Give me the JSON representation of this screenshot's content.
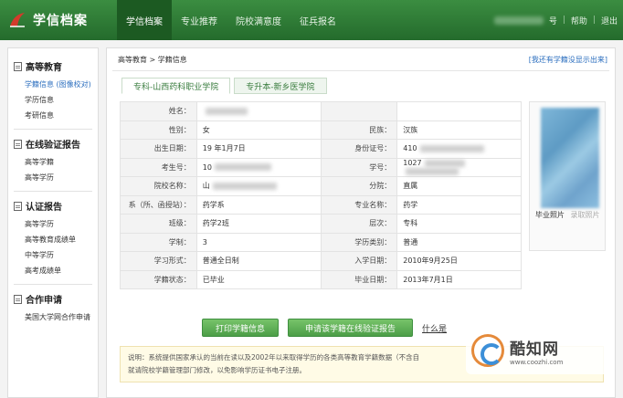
{
  "header": {
    "app_title": "学信档案",
    "nav": [
      "学信档案",
      "专业推荐",
      "院校满意度",
      "征兵报名"
    ],
    "right_links": [
      "号",
      "帮助",
      "退出"
    ]
  },
  "sidebar": {
    "sections": [
      {
        "title": "高等教育",
        "items": [
          "学籍信息 (图像校对)",
          "学历信息",
          "考研信息"
        ]
      },
      {
        "title": "在线验证报告",
        "items": [
          "高等学籍",
          "高等学历"
        ]
      },
      {
        "title": "认证报告",
        "items": [
          "高等学历",
          "高等教育成绩单",
          "中等学历",
          "高考成绩单"
        ]
      },
      {
        "title": "合作申请",
        "items": [
          "美国大学网合作申请"
        ]
      }
    ]
  },
  "main": {
    "breadcrumb": "高等教育 > 学籍信息",
    "missing_link": "[我还有学籍没显示出来]",
    "tabs": [
      "专科-山西药科职业学院",
      "专升本-新乡医学院"
    ],
    "rows": [
      {
        "l1": "姓名：",
        "v1": "",
        "l2": "",
        "v2": ""
      },
      {
        "l1": "性别：",
        "v1": "女",
        "l2": "民族：",
        "v2": "汉族"
      },
      {
        "l1": "出生日期：",
        "v1": "19   年1月7日",
        "l2": "身份证号：",
        "v2": "410"
      },
      {
        "l1": "考生号：",
        "v1": "10",
        "l2": "学号：",
        "v2": "1027"
      },
      {
        "l1": "院校名称：",
        "v1": "山",
        "l2": "分院：",
        "v2": "直属"
      },
      {
        "l1": "系（所、函授站）：",
        "v1": "药学系",
        "l2": "专业名称：",
        "v2": "药学"
      },
      {
        "l1": "班级：",
        "v1": "药学2班",
        "l2": "层次：",
        "v2": "专科"
      },
      {
        "l1": "学制：",
        "v1": "3",
        "l2": "学历类别：",
        "v2": "普通"
      },
      {
        "l1": "学习形式：",
        "v1": "普通全日制",
        "l2": "入学日期：",
        "v2": "2010年9月25日"
      },
      {
        "l1": "学籍状态：",
        "v1": "已毕业",
        "l2": "毕业日期：",
        "v2": "2013年7月1日"
      }
    ],
    "photo_caption": "毕业照片",
    "photo_sub": "录取照片",
    "btn_print": "打印学籍信息",
    "btn_apply": "申请该学籍在线验证报告",
    "whats_link": "什么是",
    "note_line1": "说明：系统提供国家承认的当前在读以及2002年以来取得学历的各类高等教育学籍数据（不含自",
    "note_line2": "就请院校学籍管理部门修改，以免影响学历证书电子注册。"
  },
  "watermark": {
    "name": "酷知网",
    "url": "www.coozhi.com"
  }
}
